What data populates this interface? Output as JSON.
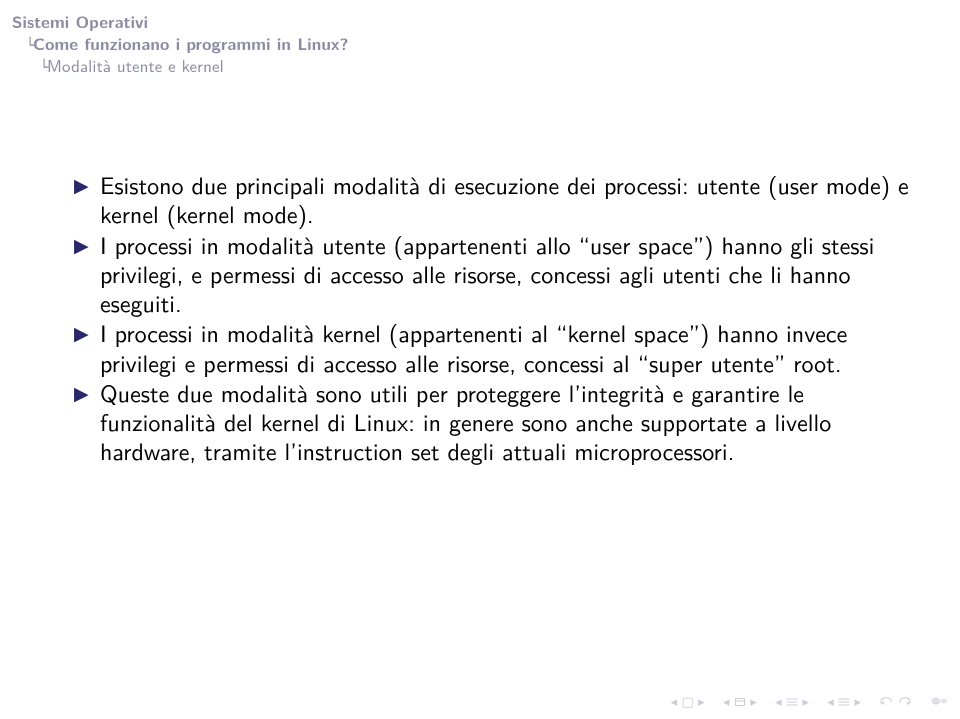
{
  "breadcrumb": {
    "level1": "Sistemi Operativi",
    "level2": "Come funzionano i programmi in Linux?",
    "level3": "Modalità utente e kernel"
  },
  "body": {
    "items": [
      "Esistono due principali modalità di esecuzione dei processi: utente (user mode) e kernel (kernel mode).",
      "I processi in modalità utente (appartenenti allo “user space”) hanno gli stessi privilegi, e permessi di accesso alle risorse, concessi agli utenti che li hanno eseguiti.",
      "I processi in modalità kernel (appartenenti al “kernel space”) hanno invece privilegi e permessi di accesso alle risorse, concessi al “super utente” root.",
      "Queste due modalità sono utili per proteggere l’integrità e garantire le funzionalità del kernel di Linux: in genere sono anche supportate a livello hardware, tramite l’instruction set degli attuali microprocessori."
    ]
  },
  "nav": {
    "first_slide": "first-slide",
    "prev_slide": "prev-slide",
    "prev_section": "prev-section",
    "next_section": "next-section",
    "prev_subsection": "prev-subsection",
    "next_subsection": "next-subsection",
    "next_slide": "next-slide",
    "last_slide": "last-slide",
    "back": "back",
    "forward": "forward",
    "search": "search"
  }
}
